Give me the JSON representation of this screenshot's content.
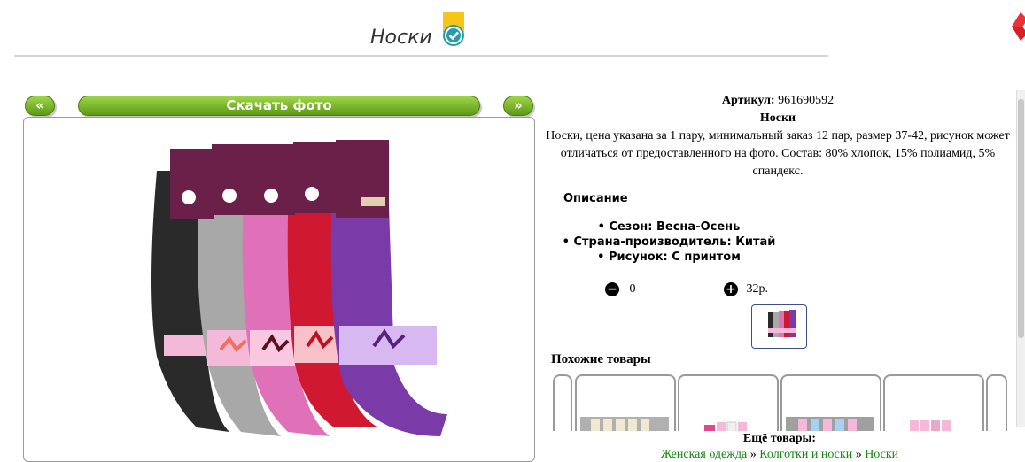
{
  "header": {
    "title": "Носки"
  },
  "gallery": {
    "prev_label": "«",
    "download_label": "Скачать фото",
    "next_label": "»"
  },
  "product": {
    "article_label": "Артикул:",
    "article_value": "961690592",
    "name": "Носки",
    "description": "Носки, цена указана за 1 пару, минимальный заказ 12 пар, размер 37-42, рисунок может отличаться от предоставленного на фото. Состав: 80% хлопок, 15% полиамид, 5% спандекс."
  },
  "details": {
    "title": "Описание",
    "properties": [
      "Сезон: Весна-Осень",
      "Страна-производитель: Китай",
      "Рисунок: С принтом"
    ]
  },
  "cart": {
    "quantity": "0",
    "price": "32р."
  },
  "similar": {
    "title": "Похожие товары"
  },
  "more": {
    "title": "Ещё товары:",
    "links": [
      "Женская одежда",
      "Колготки и носки",
      "Носки"
    ],
    "separator": "»"
  },
  "colors": {
    "accent_green": "#6aaa1a",
    "link_green": "#118811",
    "sock_colors": [
      "#2a2a2a",
      "#a8a8a8",
      "#e070b8",
      "#d01830",
      "#7a3aa8"
    ]
  },
  "icons": {
    "verified": "check-badge-icon",
    "minus": "minus-icon",
    "plus": "plus-icon"
  }
}
